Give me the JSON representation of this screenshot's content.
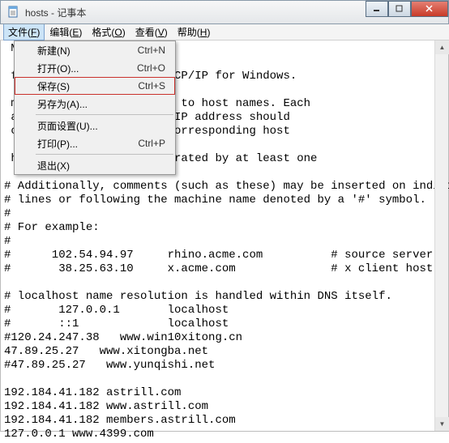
{
  "title": "hosts - 记事本",
  "menu": {
    "file": {
      "label": "文件",
      "key": "F"
    },
    "edit": {
      "label": "编辑",
      "key": "E"
    },
    "format": {
      "label": "格式",
      "key": "O"
    },
    "view": {
      "label": "查看",
      "key": "V"
    },
    "help": {
      "label": "帮助",
      "key": "H"
    }
  },
  "dropdown": {
    "new": {
      "label": "新建(N)",
      "shortcut": "Ctrl+N"
    },
    "open": {
      "label": "打开(O)...",
      "shortcut": "Ctrl+O"
    },
    "save": {
      "label": "保存(S)",
      "shortcut": "Ctrl+S"
    },
    "saveas": {
      "label": "另存为(A)...",
      "shortcut": ""
    },
    "pagesetup": {
      "label": "页面设置(U)...",
      "shortcut": ""
    },
    "print": {
      "label": "打印(P)...",
      "shortcut": "Ctrl+P"
    },
    "exit": {
      "label": "退出(X)",
      "shortcut": ""
    }
  },
  "body": " Microsoft Corp.\n\n file used by Microsoft TCP/IP for Windows.\n\n mappings of IP addresses to host names. Each\n an individual line. The IP address should\n column followed by the corresponding host\n\n host name should be separated by at least one\n\n# Additionally, comments (such as these) may be inserted on individual\n# lines or following the machine name denoted by a '#' symbol.\n#\n# For example:\n#\n#      102.54.94.97     rhino.acme.com          # source server\n#       38.25.63.10     x.acme.com              # x client host\n\n# localhost name resolution is handled within DNS itself.\n#       127.0.0.1       localhost\n#       ::1             localhost\n#120.24.247.38   www.win10xitong.cn\n47.89.25.27   www.xitongba.net\n#47.89.25.27   www.yunqishi.net\n\n192.184.41.182 astrill.com\n192.184.41.182 www.astrill.com\n192.184.41.182 members.astrill.com\n127.0.0.1 www.4399.com"
}
